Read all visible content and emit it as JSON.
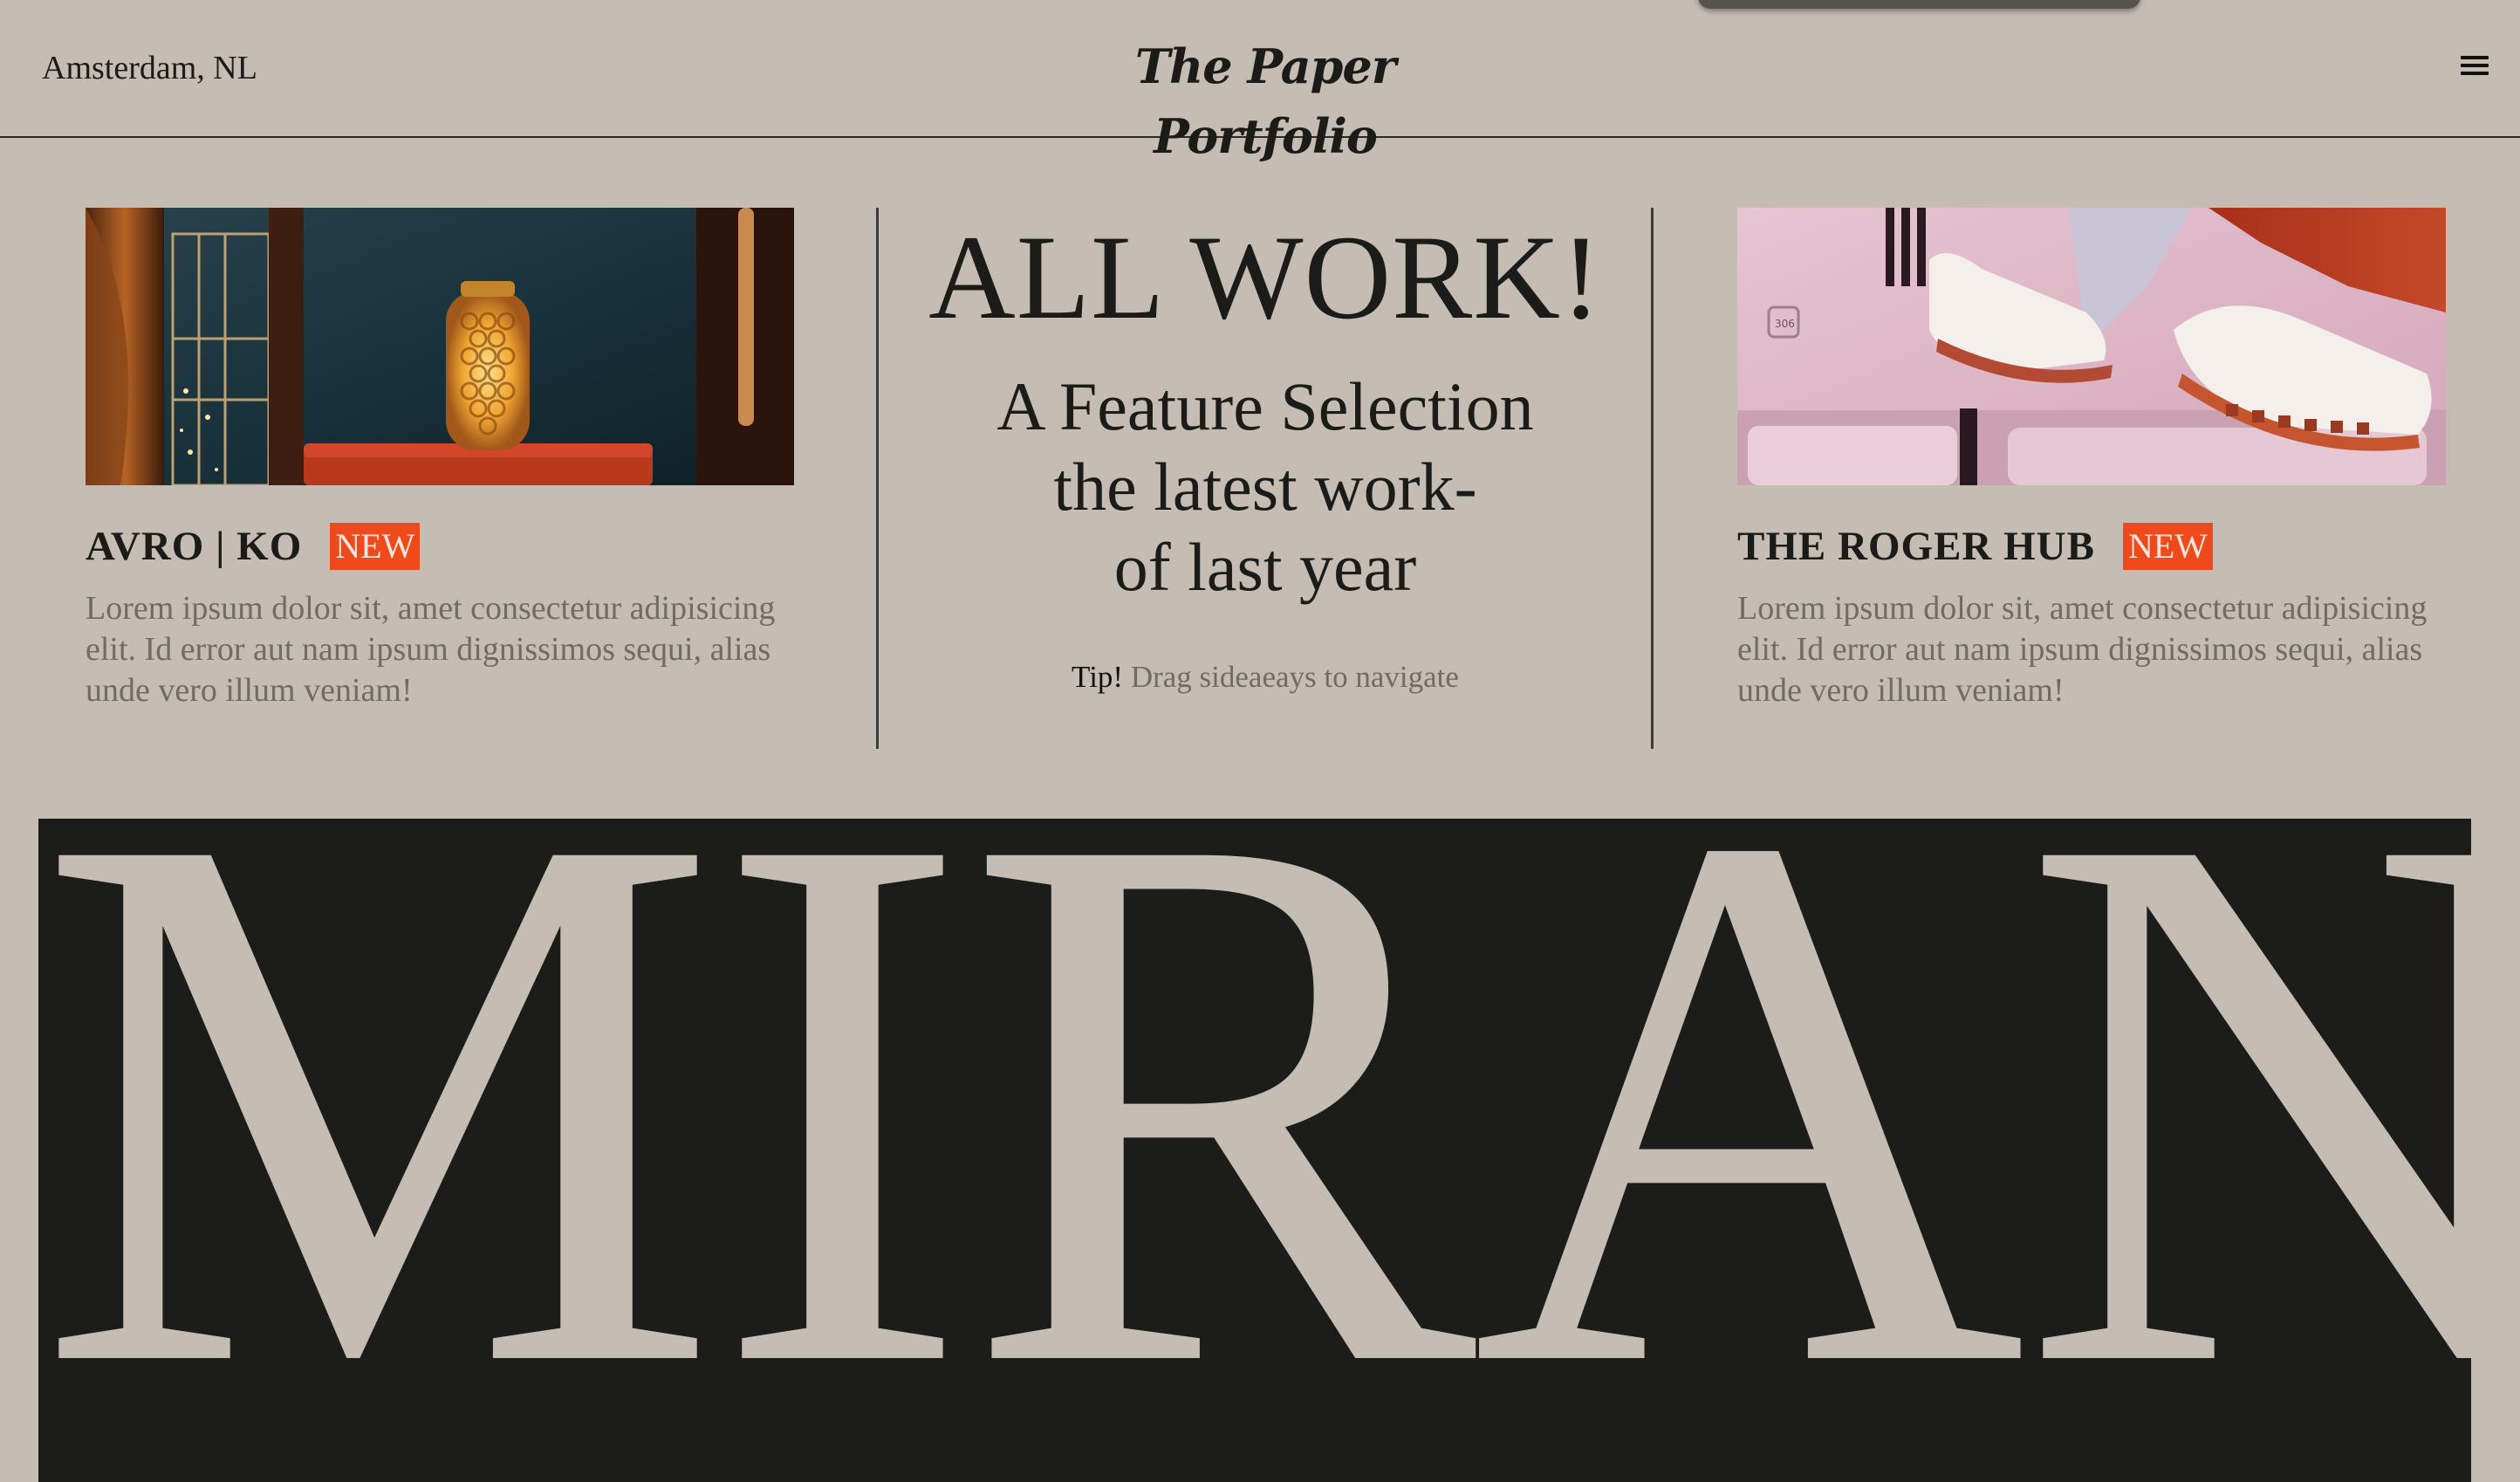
{
  "header": {
    "location": "Amsterdam, NL",
    "brand": "The Paper Portfolio",
    "menu_icon": "hamburger-menu-icon"
  },
  "hero": {
    "title": "ALL WORK!",
    "subtitle_lines": [
      "A Feature Selection",
      "the latest work-",
      "of last year"
    ],
    "tip_label": "Tip!",
    "tip_text": "Drag sideaeays to navigate"
  },
  "projects": [
    {
      "title": "AVRO | KO",
      "badge": "NEW",
      "description": "Lorem ipsum dolor sit, amet consectetur adipisicing elit. Id error aut nam ipsum dignissimos sequi, alias unde vero illum veniam!",
      "image_icon": "lantern-photo"
    },
    {
      "title": "THE ROGER HUB",
      "badge": "NEW",
      "description": "Lorem ipsum dolor sit, amet consectetur adipisicing elit. Id error aut nam ipsum dignissimos sequi, alias unde vero illum veniam!",
      "image_icon": "sneakers-photo",
      "image_label": "306"
    }
  ],
  "banner": {
    "text": "MIRAN"
  },
  "colors": {
    "background": "#c5bcb3",
    "ink": "#1b1b19",
    "muted_text": "#6f6c66",
    "badge": "#ef4a1b",
    "banner": "#1c1d1b"
  }
}
